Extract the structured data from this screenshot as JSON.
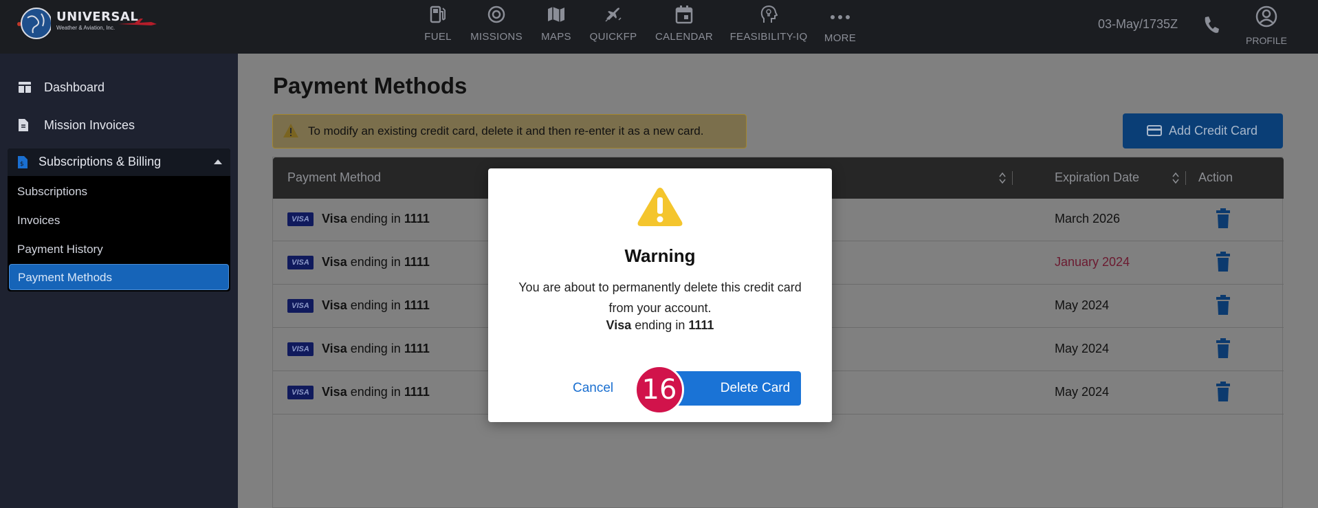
{
  "header": {
    "logo_text": "UNIVERSAL",
    "logo_subtext": "Weather & Aviation, Inc.",
    "nav": [
      {
        "label": "FUEL",
        "icon": "fuel-pump-icon"
      },
      {
        "label": "MISSIONS",
        "icon": "target-icon"
      },
      {
        "label": "MAPS",
        "icon": "map-icon"
      },
      {
        "label": "QUICKFP",
        "icon": "airplane-icon"
      },
      {
        "label": "CALENDAR",
        "icon": "calendar-icon"
      },
      {
        "label": "FEASIBILITY-IQ",
        "icon": "head-bulb-icon"
      },
      {
        "label": "MORE",
        "icon": "more-dots-icon"
      }
    ],
    "datetime": "03-May/1735Z",
    "profile_label": "PROFILE"
  },
  "sidebar": {
    "items": [
      {
        "label": "Dashboard",
        "icon": "dashboard-icon"
      },
      {
        "label": "Mission Invoices",
        "icon": "invoice-icon"
      }
    ],
    "billing": {
      "label": "Subscriptions & Billing",
      "icon": "billing-document-icon",
      "expanded": true,
      "children": [
        "Subscriptions",
        "Invoices",
        "Payment History",
        "Payment Methods"
      ],
      "active": "Payment Methods"
    }
  },
  "main": {
    "title": "Payment Methods",
    "alert_text": "To modify an existing credit card, delete it and then re-enter it as a new card.",
    "add_button_label": "Add Credit Card",
    "table": {
      "columns": [
        "Payment Method",
        "Expiration Date",
        "Action"
      ],
      "rows": [
        {
          "brand": "Visa",
          "middle": "ending in",
          "last4": "1111",
          "expiration": "March 2026",
          "expired": false
        },
        {
          "brand": "Visa",
          "middle": "ending in",
          "last4": "1111",
          "expiration": "January 2024",
          "expired": true
        },
        {
          "brand": "Visa",
          "middle": "ending in",
          "last4": "1111",
          "expiration": "May 2024",
          "expired": false
        },
        {
          "brand": "Visa",
          "middle": "ending in",
          "last4": "1111",
          "expiration": "May 2024",
          "expired": false
        },
        {
          "brand": "Visa",
          "middle": "ending in",
          "last4": "1111",
          "expiration": "May 2024",
          "expired": false
        }
      ],
      "card_badge": "VISA"
    }
  },
  "modal": {
    "title": "Warning",
    "message": "You are about to permanently delete this credit card from your account.",
    "card_brand": "Visa",
    "card_middle": "ending in",
    "card_last4": "1111",
    "cancel_label": "Cancel",
    "delete_label": "Delete Card",
    "step_badge": "16"
  },
  "colors": {
    "accent": "#1a73d6",
    "expired": "#d1134b",
    "warning": "#f4c52d"
  }
}
